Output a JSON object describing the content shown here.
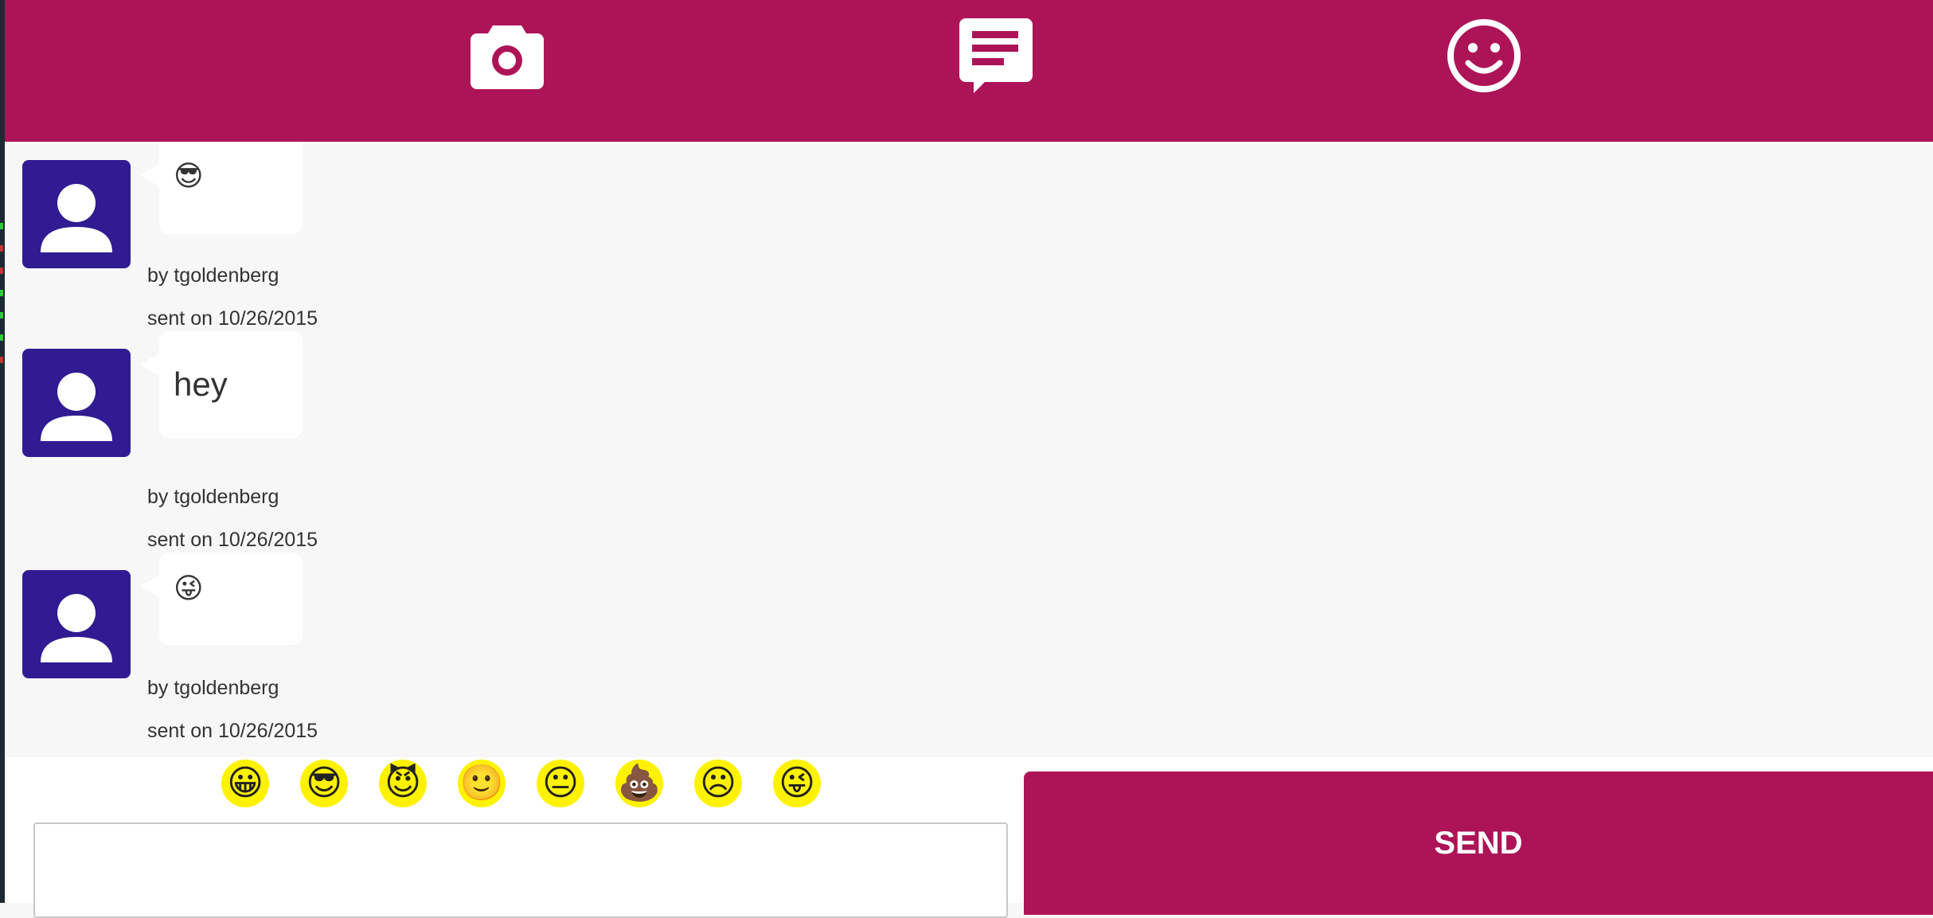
{
  "header": {
    "icons": [
      "camera-icon",
      "chat-icon",
      "smiley-icon"
    ],
    "background": "#ad1457"
  },
  "messages": [
    {
      "content_emoji": "😎",
      "content_text": "",
      "author_line": "by tgoldenberg",
      "sent_line": "sent on 10/26/2015"
    },
    {
      "content_emoji": "",
      "content_text": "hey",
      "author_line": "by tgoldenberg",
      "sent_line": "sent on 10/26/2015"
    },
    {
      "content_emoji": "😜",
      "content_text": "",
      "author_line": "by tgoldenberg",
      "sent_line": "sent on 10/26/2015"
    }
  ],
  "emoji_picker": [
    {
      "glyph": "😀",
      "icon": "grinning-face-icon"
    },
    {
      "glyph": "😎",
      "icon": "sunglasses-face-icon"
    },
    {
      "glyph": "😈",
      "icon": "devil-face-icon"
    },
    {
      "glyph": "🙂",
      "icon": "smiling-face-icon"
    },
    {
      "glyph": "😐",
      "icon": "neutral-face-icon"
    },
    {
      "glyph": "💩",
      "icon": "poop-icon"
    },
    {
      "glyph": "☹",
      "icon": "frowning-face-icon"
    },
    {
      "glyph": "😜",
      "icon": "winking-tongue-face-icon"
    }
  ],
  "composer": {
    "input_value": "",
    "send_label": "SEND"
  },
  "colors": {
    "accent": "#ad1457",
    "avatar": "#311b92",
    "emoji_bg": "#fff200",
    "background": "#f7f7f7"
  }
}
